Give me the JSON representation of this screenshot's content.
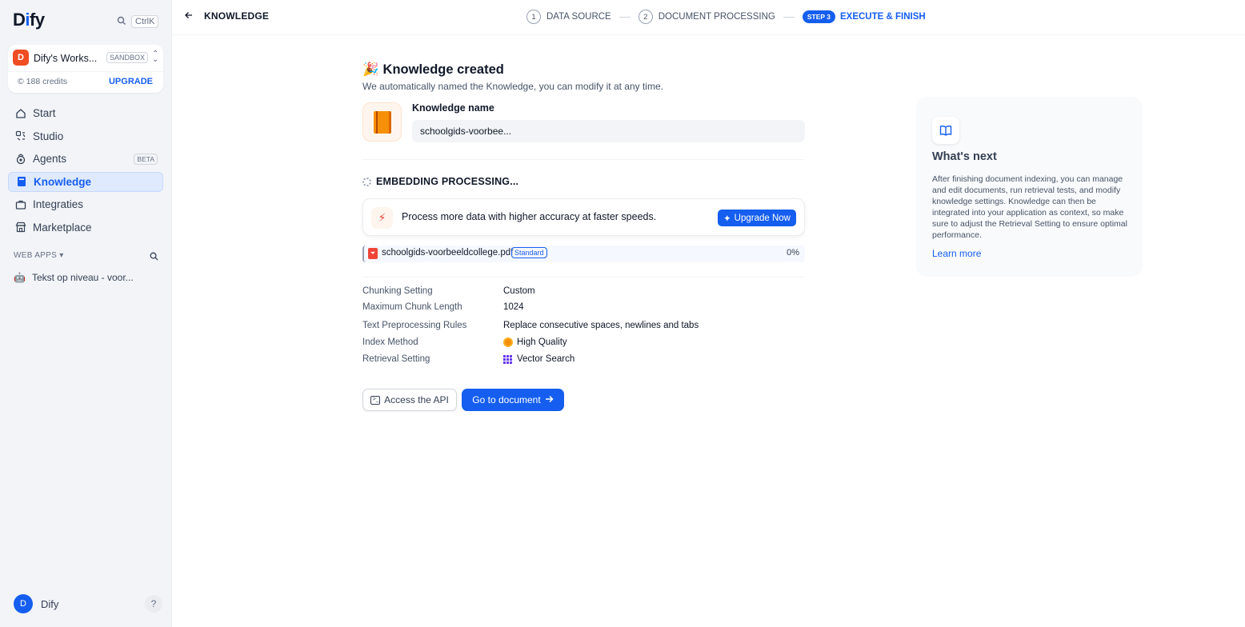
{
  "sidebar": {
    "logo_pre": "D",
    "logo_i": "i",
    "logo_post": "fy",
    "shortcut": "CtrlK",
    "workspace": {
      "initial": "D",
      "name": "Dify's Works...",
      "badge": "SANDBOX",
      "credits": "188 credits",
      "upgrade": "UPGRADE"
    },
    "nav": [
      {
        "label": "Start",
        "icon": "home-icon"
      },
      {
        "label": "Studio",
        "icon": "studio-icon"
      },
      {
        "label": "Agents",
        "icon": "agent-icon",
        "badge": "BETA"
      },
      {
        "label": "Knowledge",
        "icon": "book-icon"
      },
      {
        "label": "Integraties",
        "icon": "briefcase-icon"
      },
      {
        "label": "Marketplace",
        "icon": "store-icon"
      }
    ],
    "web_apps_label": "WEB APPS",
    "web_app_item": {
      "emoji": "🤖",
      "label": "Tekst op niveau - voor..."
    },
    "user": {
      "initial": "D",
      "name": "Dify"
    },
    "help": "?"
  },
  "header": {
    "back_label": "KNOWLEDGE",
    "steps": [
      {
        "num": "1",
        "label": "DATA SOURCE"
      },
      {
        "num": "2",
        "label": "DOCUMENT PROCESSING"
      }
    ],
    "active_step": {
      "num": "STEP 3",
      "label": "EXECUTE & FINISH"
    }
  },
  "main": {
    "title_emoji": "🎉",
    "title": "Knowledge created",
    "subtitle": "We automatically named the Knowledge, you can modify it at any time.",
    "name_label": "Knowledge name",
    "name_value": "schoolgids-voorbee...",
    "embedding_status": "EMBEDDING PROCESSING...",
    "upgrade_text": "Process more data with higher accuracy at faster speeds.",
    "upgrade_button": "Upgrade Now",
    "file": {
      "name": "schoolgids-voorbeeldcollege.pdf",
      "badge": "Standard",
      "progress": "0%"
    },
    "settings": [
      {
        "key": "Chunking Setting",
        "value": "Custom"
      },
      {
        "key": "Maximum Chunk Length",
        "value": "1024"
      },
      {
        "key": "Text Preprocessing Rules",
        "value": "Replace consecutive spaces, newlines and tabs"
      },
      {
        "key": "Index Method",
        "value": "High Quality"
      },
      {
        "key": "Retrieval Setting",
        "value": "Vector Search"
      }
    ],
    "api_button": "Access the API",
    "go_button": "Go to document"
  },
  "next": {
    "title": "What's next",
    "body": "After finishing document indexing, you can manage and edit documents, run retrieval tests, and modify knowledge settings. Knowledge can then be integrated into your application as context, so make sure to adjust the Retrieval Setting to ensure optimal performance.",
    "link": "Learn more"
  },
  "colors": {
    "accent": "#155eef",
    "workspace_avatar": "#f04d23"
  }
}
